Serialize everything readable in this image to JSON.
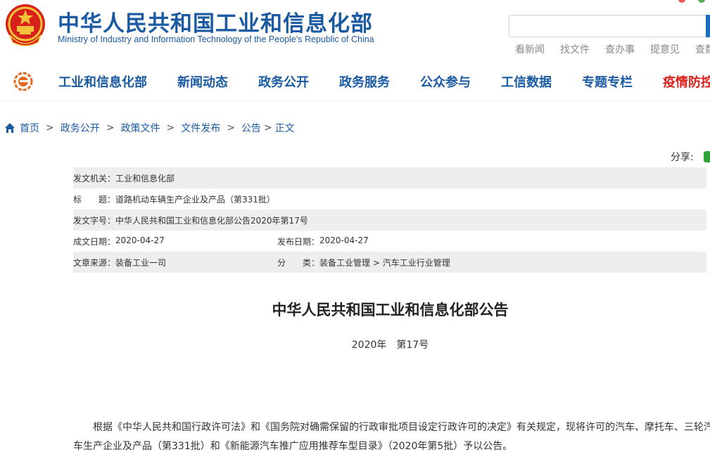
{
  "header": {
    "title_cn": "中华人民共和国工业和信息化部",
    "title_en": "Ministry of Industry and Information Technology of the People's Republic of China",
    "quick_links": [
      "看新闻",
      "找文件",
      "查办事",
      "提意见",
      "查数"
    ]
  },
  "nav": {
    "items": [
      {
        "label": "工业和信息化部",
        "hot": false
      },
      {
        "label": "新闻动态",
        "hot": false
      },
      {
        "label": "政务公开",
        "hot": false
      },
      {
        "label": "政务服务",
        "hot": false
      },
      {
        "label": "公众参与",
        "hot": false
      },
      {
        "label": "工信数据",
        "hot": false
      },
      {
        "label": "专题专栏",
        "hot": false
      },
      {
        "label": "疫情防控",
        "hot": true
      }
    ]
  },
  "breadcrumb": {
    "items": [
      "首页",
      "政务公开",
      "政策文件",
      "文件发布",
      "公告"
    ],
    "separators": [
      ">",
      ">",
      ">",
      ">",
      ">"
    ],
    "current": "正文"
  },
  "share": {
    "label": "分享:"
  },
  "info": {
    "issuer_key": "发文机关：",
    "issuer": "工业和信息化部",
    "title_key": "标　　题：",
    "title": "道路机动车辆生产企业及产品（第331批）",
    "doc_no_key": "发文字号：",
    "doc_no": "中华人民共和国工业和信息化部公告2020年第17号",
    "created_key": "成文日期：",
    "created": "2020-04-27",
    "published_key": "发布日期：",
    "published": "2020-04-27",
    "source_key": "文章来源：",
    "source": "装备工业一司",
    "category_key": "分　　类：",
    "category": "装备工业管理 > 汽车工业行业管理"
  },
  "document": {
    "title": "中华人民共和国工业和信息化部公告",
    "number": "2020年　第17号",
    "body": "根据《中华人民共和国行政许可法》和《国务院对确需保留的行政审批项目设定行政许可的决定》有关规定，现将许可的汽车、摩托车、三轮汽车生产企业及产品（第331批）和《新能源汽车推广应用推荐车型目录》（2020年第5批）予以公告。"
  },
  "colors": {
    "brand_blue": "#1a5aa3",
    "hot_red": "#d9211c",
    "row_shade": "#eeeeee"
  }
}
